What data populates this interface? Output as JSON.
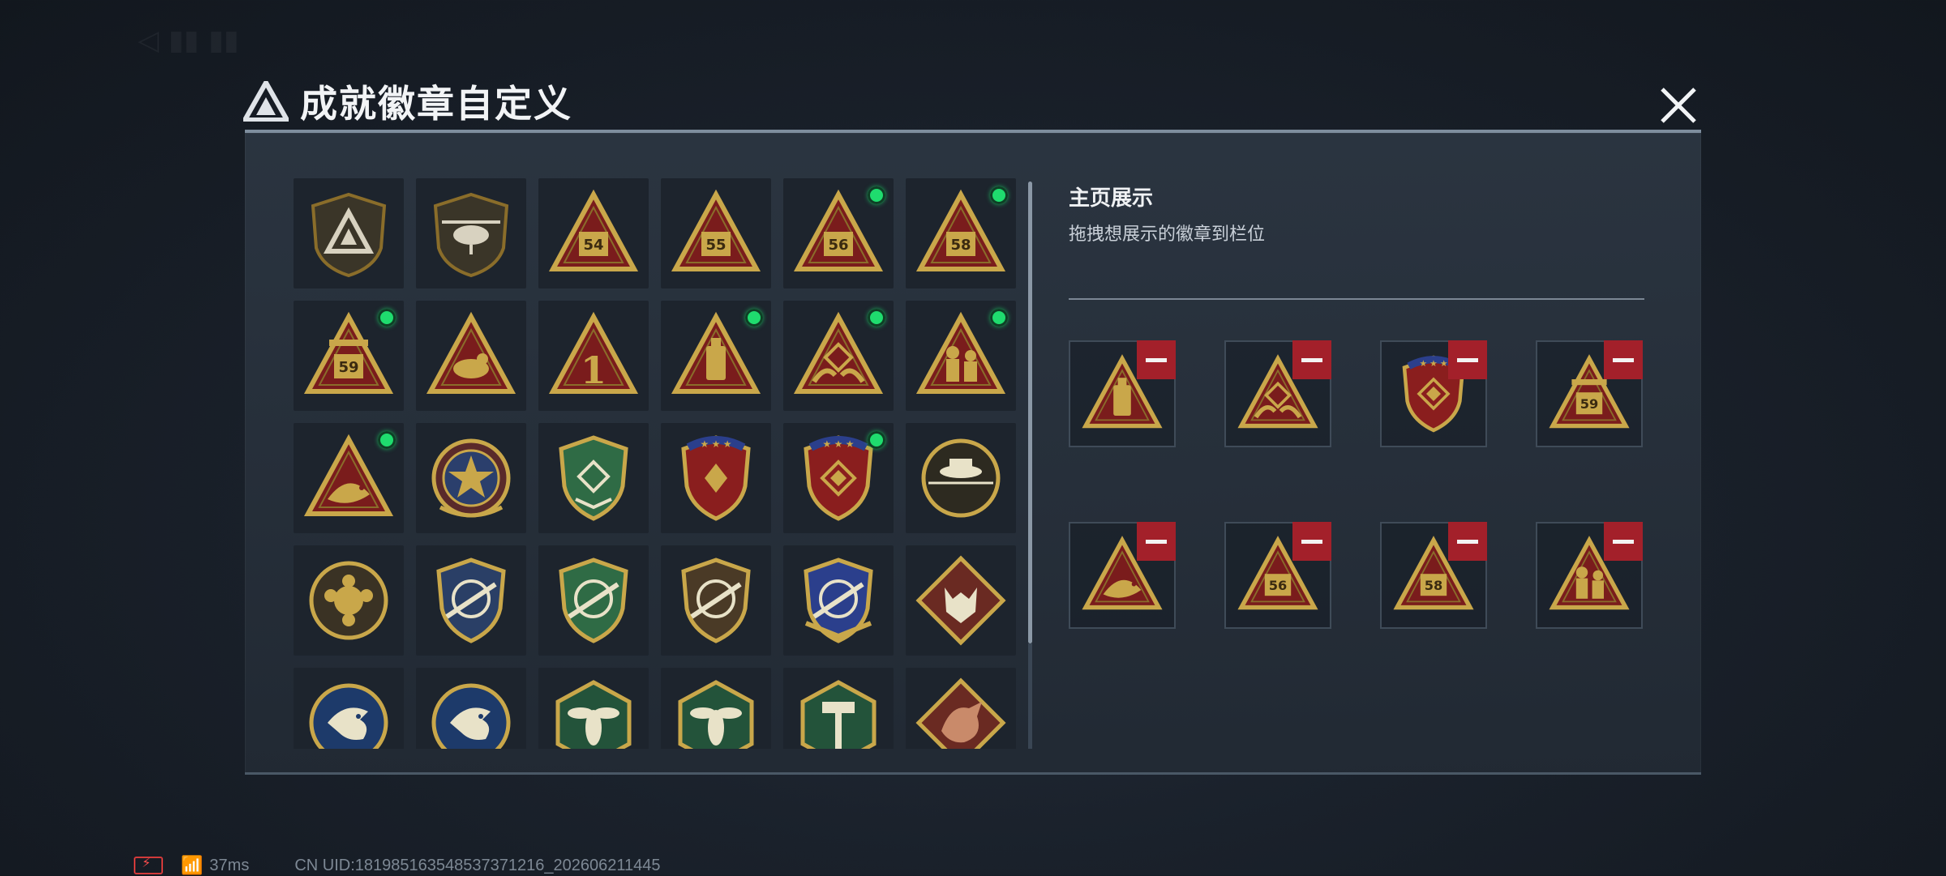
{
  "header": {
    "title": "成就徽章自定义"
  },
  "showcase": {
    "title": "主页展示",
    "subtitle": "拖拽想展示的徽章到栏位"
  },
  "status": {
    "ping": "37ms",
    "uid": "CN UID:1819851635485373712​16_202606211445"
  },
  "colors": {
    "accent_new": "#1fdc6e",
    "remove": "#a3202a",
    "gold": "#c9a74a",
    "panel": "#2a3440"
  },
  "badges": [
    {
      "icon": "shield-logo-badge",
      "new": false
    },
    {
      "icon": "helicopter-badge",
      "new": false
    },
    {
      "icon": "triangle-54-badge",
      "new": false
    },
    {
      "icon": "triangle-55-badge",
      "new": false
    },
    {
      "icon": "triangle-56-badge",
      "new": true
    },
    {
      "icon": "triangle-58-badge",
      "new": true
    },
    {
      "icon": "triangle-59-badge",
      "new": true
    },
    {
      "icon": "triangle-bird-badge",
      "new": false
    },
    {
      "icon": "triangle-1-badge",
      "new": false
    },
    {
      "icon": "triangle-bottle-badge",
      "new": true
    },
    {
      "icon": "triangle-hands-badge",
      "new": true
    },
    {
      "icon": "triangle-soldiers-badge",
      "new": true
    },
    {
      "icon": "triangle-fish-badge",
      "new": true
    },
    {
      "icon": "star-crest-badge",
      "new": false
    },
    {
      "icon": "green-shield-badge",
      "new": false
    },
    {
      "icon": "red-shield-stars-badge",
      "new": false
    },
    {
      "icon": "red-shield-stars-2-badge",
      "new": true
    },
    {
      "icon": "round-hat-badge",
      "new": false
    },
    {
      "icon": "round-emblem-badge",
      "new": false
    },
    {
      "icon": "blue-crosshair-badge",
      "new": false
    },
    {
      "icon": "green-crosshair-badge",
      "new": false
    },
    {
      "icon": "brown-crosshair-badge",
      "new": false
    },
    {
      "icon": "gold-blue-crosshair-badge",
      "new": false
    },
    {
      "icon": "wolf-diamond-badge",
      "new": false
    },
    {
      "icon": "eagle-round-badge",
      "new": false
    },
    {
      "icon": "eagle-round-2-badge",
      "new": false
    },
    {
      "icon": "wasp-hex-badge",
      "new": false
    },
    {
      "icon": "wasp-hex-2-badge",
      "new": false
    },
    {
      "icon": "hammer-hex-badge",
      "new": false
    },
    {
      "icon": "dragon-diamond-badge",
      "new": false
    }
  ],
  "slots": [
    {
      "icon": "triangle-bottle-badge"
    },
    {
      "icon": "triangle-hands-badge"
    },
    {
      "icon": "red-shield-stars-2-badge"
    },
    {
      "icon": "triangle-59-badge"
    },
    {
      "icon": "triangle-fish-badge"
    },
    {
      "icon": "triangle-56-badge"
    },
    {
      "icon": "triangle-58-badge"
    },
    {
      "icon": "triangle-soldiers-badge"
    }
  ]
}
